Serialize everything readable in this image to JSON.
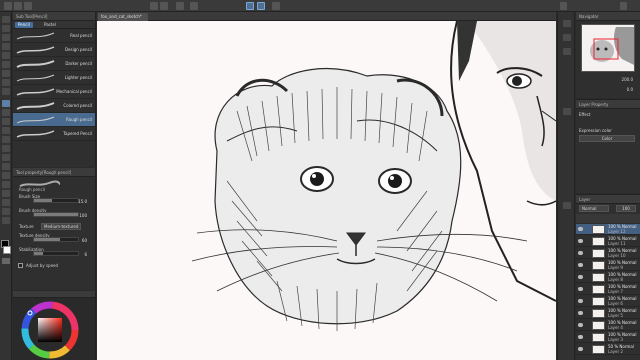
{
  "menubar": {
    "toolbar_icons": [
      "new-icon",
      "open-icon",
      "save-icon",
      "undo-icon",
      "redo-icon",
      "clear-icon",
      "transform-icon",
      "snap-icon",
      "ruler-snap-icon",
      "grid-icon"
    ]
  },
  "sub_tool": {
    "title": "Sub Tool[Pencil]",
    "tabs": [
      "Pencil",
      "Pastel"
    ],
    "items": [
      {
        "label": "Real pencil"
      },
      {
        "label": "Design pencil"
      },
      {
        "label": "Darker pencil"
      },
      {
        "label": "Lighter pencil"
      },
      {
        "label": "Mechanical pencil"
      },
      {
        "label": "Colored pencil"
      },
      {
        "label": "Rough pencil"
      },
      {
        "label": "Tapered Pencil"
      }
    ],
    "selected_index": 6
  },
  "tool_property": {
    "title": "Tool property[Rough pencil]",
    "preset": "Rough pencil",
    "brush_size_label": "Brush Size",
    "brush_size_value": "15.0",
    "brush_density_label": "Brush density",
    "brush_density_value": "100",
    "texture_label": "Texture",
    "texture_value": "Medium-textured",
    "texture_density_label": "Texture density",
    "texture_density_value": "60",
    "stabilization_label": "Stabilization",
    "stabilization_value": "6",
    "adjust_label": "Adjust by speed"
  },
  "document": {
    "tab_title": "fox_and_cat_sketch*"
  },
  "navigator": {
    "title": "Navigator",
    "zoom": "200.0",
    "rotation": "0.0"
  },
  "layer_property": {
    "title": "Layer Property",
    "effect_label": "Effect",
    "expression_label": "Expression color",
    "expression_value": "Color"
  },
  "layers": {
    "title": "Layer",
    "blend_mode": "Normal",
    "opacity": "100",
    "rows": [
      {
        "line1": "100 % Normal",
        "line2": "Layer 12"
      },
      {
        "line1": "100 % Normal",
        "line2": "Layer 11"
      },
      {
        "line1": "100 % Normal",
        "line2": "Layer 10"
      },
      {
        "line1": "100 % Normal",
        "line2": "Layer 9"
      },
      {
        "line1": "100 % Normal",
        "line2": "Layer 8"
      },
      {
        "line1": "100 % Normal",
        "line2": "Layer 7"
      },
      {
        "line1": "100 % Normal",
        "line2": "Layer 6"
      },
      {
        "line1": "100 % Normal",
        "line2": "Layer 5"
      },
      {
        "line1": "100 % Normal",
        "line2": "Layer 4"
      },
      {
        "line1": "100 % Normal",
        "line2": "Layer 3"
      },
      {
        "line1": "50 % Normal",
        "line2": "Layer 2"
      }
    ],
    "selected_index": 0
  },
  "colors": {
    "accent": "#456c9a",
    "main_color": "#000000",
    "sub_color": "#ffffff",
    "wheel_marker": "#d83a2a"
  }
}
